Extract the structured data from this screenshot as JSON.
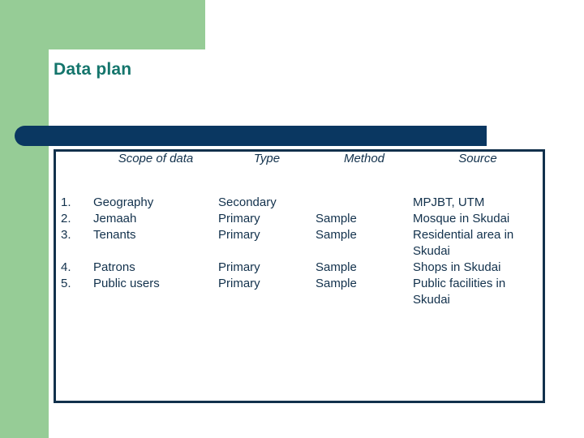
{
  "slide": {
    "title": "Data plan",
    "accent_green": "#96cc96",
    "accent_navy": "#0a3761",
    "title_color": "#14756c",
    "table_border_color": "#12314c",
    "text_color": "#12314c"
  },
  "table": {
    "headers": {
      "number": "",
      "scope": "Scope of data",
      "type": "Type",
      "method": "Method",
      "source": "Source"
    },
    "rows": [
      {
        "number": "1.",
        "scope": "Geography",
        "type": "Secondary",
        "method": "",
        "source": "MPJBT, UTM"
      },
      {
        "number": "2.",
        "scope": "Jemaah",
        "type": "Primary",
        "method": "Sample",
        "source": "Mosque in Skudai"
      },
      {
        "number": "3.",
        "scope": "Tenants",
        "type": "Primary",
        "method": "Sample",
        "source": "Residential area in Skudai"
      },
      {
        "number": "4.",
        "scope": "Patrons",
        "type": "Primary",
        "method": "Sample",
        "source": "Shops in Skudai"
      },
      {
        "number": "5.",
        "scope": "Public users",
        "type": "Primary",
        "method": "Sample",
        "source": "Public facilities in Skudai"
      }
    ]
  }
}
